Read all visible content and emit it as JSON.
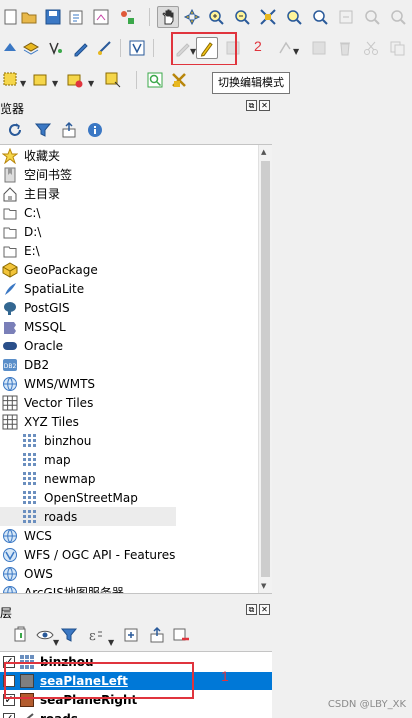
{
  "toolbar1": {
    "buttons": [
      {
        "name": "open-project-icon"
      },
      {
        "name": "save-project-icon"
      },
      {
        "name": "save-as-icon"
      },
      {
        "name": "print-layout-icon"
      },
      {
        "name": "style-manager-icon"
      },
      {
        "name": "pan-tool-icon"
      },
      {
        "name": "pan-to-selection-icon"
      },
      {
        "name": "zoom-in-icon"
      },
      {
        "name": "zoom-out-icon"
      },
      {
        "name": "zoom-full-icon"
      },
      {
        "name": "zoom-selection-icon"
      },
      {
        "name": "zoom-layer-icon"
      },
      {
        "name": "zoom-native-icon"
      },
      {
        "name": "zoom-last-icon"
      }
    ]
  },
  "toolbar2": {
    "annotation_number": "2"
  },
  "tooltip": {
    "text": "切换编辑模式"
  },
  "browser": {
    "title": "览器",
    "items": [
      {
        "label": "收藏夹",
        "icon": "favorites-star-icon"
      },
      {
        "label": "空间书签",
        "icon": "spatial-bookmarks-icon"
      },
      {
        "label": "主目录",
        "icon": "home-folder-icon"
      },
      {
        "label": "C:\\",
        "icon": "drive-folder-icon"
      },
      {
        "label": "D:\\",
        "icon": "drive-folder-icon"
      },
      {
        "label": "E:\\",
        "icon": "drive-folder-icon"
      },
      {
        "label": "GeoPackage",
        "icon": "geopackage-icon"
      },
      {
        "label": "SpatiaLite",
        "icon": "spatialite-icon"
      },
      {
        "label": "PostGIS",
        "icon": "postgis-elephant-icon"
      },
      {
        "label": "MSSQL",
        "icon": "mssql-icon"
      },
      {
        "label": "Oracle",
        "icon": "oracle-icon"
      },
      {
        "label": "DB2",
        "icon": "db2-icon"
      },
      {
        "label": "WMS/WMTS",
        "icon": "wms-globe-icon"
      },
      {
        "label": "Vector Tiles",
        "icon": "vector-tiles-grid-icon"
      },
      {
        "label": "XYZ Tiles",
        "icon": "xyz-tiles-grid-icon"
      },
      {
        "label": "binzhou",
        "icon": "xyz-layer-icon"
      },
      {
        "label": "map",
        "icon": "xyz-layer-icon"
      },
      {
        "label": "newmap",
        "icon": "xyz-layer-icon"
      },
      {
        "label": "OpenStreetMap",
        "icon": "xyz-layer-icon"
      },
      {
        "label": "roads",
        "icon": "xyz-layer-icon"
      },
      {
        "label": "WCS",
        "icon": "wcs-globe-icon"
      },
      {
        "label": "WFS / OGC API - Features",
        "icon": "wfs-globe-icon"
      },
      {
        "label": "OWS",
        "icon": "ows-globe-icon"
      },
      {
        "label": "ArcGIS地图服务器",
        "icon": "arcgis-globe-icon"
      }
    ]
  },
  "layers": {
    "title": "层",
    "annotation_number": "1",
    "items": [
      {
        "label": "binzhou",
        "checked": true,
        "symbol": "raster-grid-icon"
      },
      {
        "label": "seaPlaneLeft",
        "checked": true,
        "symbol": "polygon-symbol",
        "color": "#7f7f7f",
        "selected": true
      },
      {
        "label": "seaPlaneRight",
        "checked": true,
        "symbol": "polygon-symbol",
        "color": "#b35c2e"
      },
      {
        "label": "roads",
        "checked": true,
        "symbol": "line-symbol"
      }
    ]
  },
  "watermark": "CSDN @LBY_XK",
  "colors": {
    "annotation_red": "#e0343d",
    "selection_blue": "#0078d7"
  }
}
